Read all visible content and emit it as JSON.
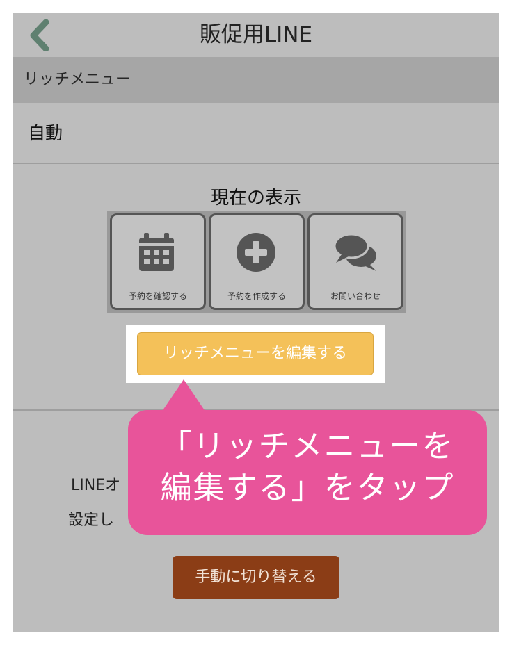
{
  "header": {
    "title": "販促用LINE",
    "back_icon": "chevron-left-icon",
    "back_color": "#5f8070"
  },
  "section": {
    "label": "リッチメニュー"
  },
  "mode": {
    "value": "自動"
  },
  "current_display": {
    "label": "現在の表示",
    "tiles": [
      {
        "icon": "calendar-icon",
        "label": "予約を確認する"
      },
      {
        "icon": "plus-circle-icon",
        "label": "予約を作成する"
      },
      {
        "icon": "chat-bubbles-icon",
        "label": "お問い合わせ"
      }
    ]
  },
  "edit_button": {
    "label": "リッチメニューを編集する",
    "color": "#f4c159"
  },
  "description": {
    "line1": "LINEオ",
    "line2": "設定し"
  },
  "manual_button": {
    "label": "手動に切り替える",
    "color": "#8b3d16"
  },
  "callout": {
    "line1": "「リッチメニューを",
    "line2": "編集する」をタップ",
    "color": "#e8549a"
  }
}
